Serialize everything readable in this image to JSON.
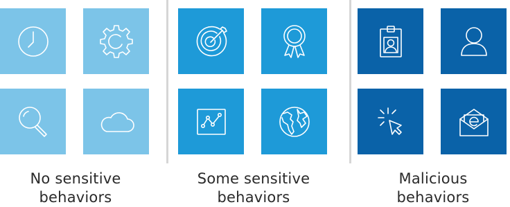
{
  "groups": [
    {
      "caption_line1": "No sensitive",
      "caption_line2": "behaviors",
      "tile_color": "#7cc4e8",
      "icons": [
        "clock-icon",
        "gear-icon",
        "magnifier-icon",
        "cloud-icon"
      ]
    },
    {
      "caption_line1": "Some sensitive",
      "caption_line2": "behaviors",
      "tile_color": "#1e9ad8",
      "icons": [
        "target-icon",
        "award-ribbon-icon",
        "line-chart-icon",
        "globe-icon"
      ]
    },
    {
      "caption_line1": "Malicious",
      "caption_line2": "behaviors",
      "tile_color": "#0a62a8",
      "icons": [
        "id-badge-icon",
        "user-icon",
        "cursor-click-icon",
        "email-envelope-icon"
      ]
    }
  ],
  "divider_color": "#d6d6d6"
}
